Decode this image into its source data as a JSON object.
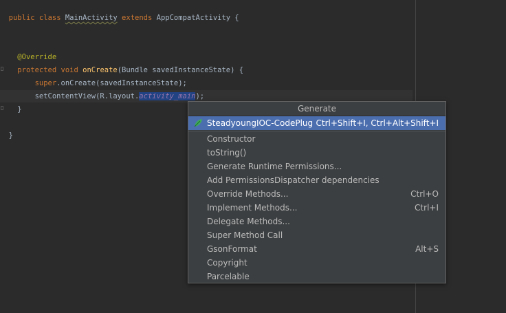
{
  "editor": {
    "line1": {
      "kw1": "public",
      "kw2": "class",
      "cls": "MainActivity",
      "kw3": "extends",
      "rest": "AppCompatActivity {"
    },
    "line2": {
      "annotation": "@Override"
    },
    "line3": {
      "kw1": "protected",
      "kw2": "void",
      "fn": "onCreate",
      "rest": "(Bundle savedInstanceState) {"
    },
    "line4": {
      "kw": "super",
      "rest": ".onCreate(savedInstanceState);"
    },
    "line5": {
      "pre": "setContentView(R.layout.",
      "field": "activity_main",
      "post": ");"
    },
    "line6": {
      "text": "}"
    },
    "line7": {
      "text": "}"
    }
  },
  "popup": {
    "title": "Generate",
    "items": [
      {
        "label": "SteadyoungIOC-CodePlug",
        "shortcut": "Ctrl+Shift+I, Ctrl+Alt+Shift+I",
        "icon": "leaf-icon",
        "selected": true
      },
      {
        "label": "Constructor",
        "shortcut": ""
      },
      {
        "label": "toString()",
        "shortcut": ""
      },
      {
        "label": "Generate Runtime Permissions...",
        "shortcut": ""
      },
      {
        "label": "Add PermissionsDispatcher dependencies",
        "shortcut": ""
      },
      {
        "label": "Override Methods...",
        "shortcut": "Ctrl+O"
      },
      {
        "label": "Implement Methods...",
        "shortcut": "Ctrl+I"
      },
      {
        "label": "Delegate Methods...",
        "shortcut": ""
      },
      {
        "label": "Super Method Call",
        "shortcut": ""
      },
      {
        "label": "GsonFormat",
        "shortcut": "Alt+S"
      },
      {
        "label": "Copyright",
        "shortcut": ""
      },
      {
        "label": "Parcelable",
        "shortcut": ""
      }
    ]
  },
  "colors": {
    "background": "#2b2b2b",
    "keyword": "#cc7832",
    "annotation": "#bbb529",
    "method": "#ffc66d",
    "field": "#9876aa",
    "selection": "#4b6eaf"
  }
}
